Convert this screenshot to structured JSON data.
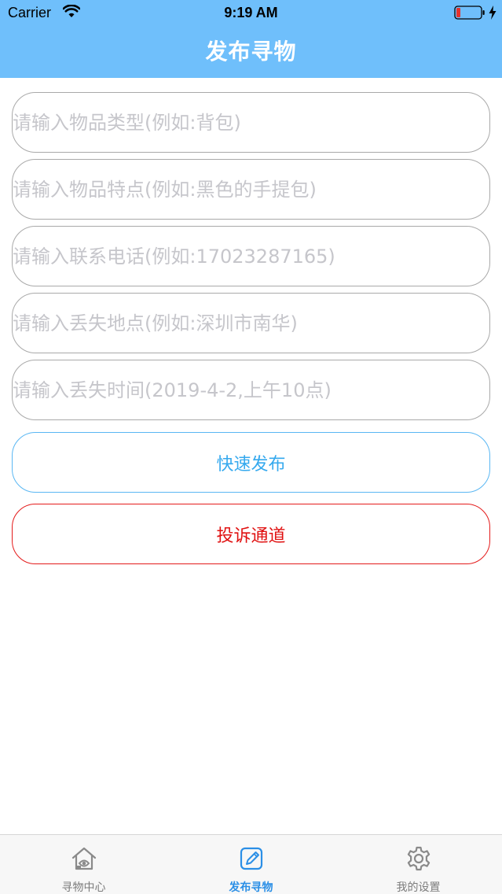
{
  "status_bar": {
    "carrier": "Carrier",
    "time": "9:19 AM"
  },
  "nav": {
    "title": "发布寻物"
  },
  "form": {
    "fields": [
      {
        "placeholder": "请输入物品类型(例如:背包)",
        "value": ""
      },
      {
        "placeholder": "请输入物品特点(例如:黑色的手提包)",
        "value": ""
      },
      {
        "placeholder": "请输入联系电话(例如:17023287165)",
        "value": ""
      },
      {
        "placeholder": "请输入丢失地点(例如:深圳市南华)",
        "value": ""
      },
      {
        "placeholder": "请输入丢失时间(2019-4-2,上午10点)",
        "value": ""
      }
    ],
    "publish_button": "快速发布",
    "complain_button": "投诉通道"
  },
  "tab_bar": {
    "items": [
      {
        "label": "寻物中心",
        "icon": "home-eye-icon",
        "active": false
      },
      {
        "label": "发布寻物",
        "icon": "edit-icon",
        "active": true
      },
      {
        "label": "我的设置",
        "icon": "gear-icon",
        "active": false
      }
    ]
  },
  "colors": {
    "nav_background": "#6fbffb",
    "publish_accent": "#35a9ee",
    "complain_accent": "#e01010",
    "tab_active": "#2b8fe6",
    "tab_inactive": "#7c7c7c"
  }
}
